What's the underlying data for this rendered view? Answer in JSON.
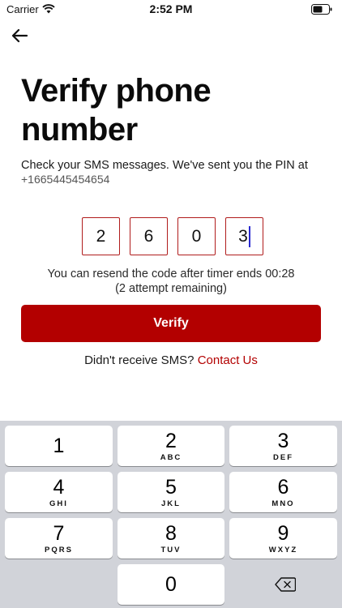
{
  "status_bar": {
    "carrier": "Carrier",
    "time": "2:52 PM"
  },
  "header": {
    "back_icon": "back-arrow-icon"
  },
  "title": "Verify phone number",
  "subtitle": "Check your SMS messages. We've sent you the PIN at",
  "phone_number": "+1665445454654",
  "pin_digits": [
    "2",
    "6",
    "0",
    "3"
  ],
  "timer": {
    "line1": "You can resend the code after timer ends 00:28",
    "line2": "(2 attempt remaining)"
  },
  "verify_label": "Verify",
  "help": {
    "prompt": "Didn't receive SMS?",
    "link": "Contact Us"
  },
  "colors": {
    "accent": "#b30000",
    "pin_border": "#b01c1c",
    "caret": "#2a2ad0",
    "keyboard_bg": "#d1d3d9"
  },
  "keypad": [
    {
      "num": "1",
      "letters": ""
    },
    {
      "num": "2",
      "letters": "ABC"
    },
    {
      "num": "3",
      "letters": "DEF"
    },
    {
      "num": "4",
      "letters": "GHI"
    },
    {
      "num": "5",
      "letters": "JKL"
    },
    {
      "num": "6",
      "letters": "MNO"
    },
    {
      "num": "7",
      "letters": "PQRS"
    },
    {
      "num": "8",
      "letters": "TUV"
    },
    {
      "num": "9",
      "letters": "WXYZ"
    },
    {
      "num": "0",
      "letters": ""
    }
  ],
  "backspace_icon": "backspace-icon"
}
